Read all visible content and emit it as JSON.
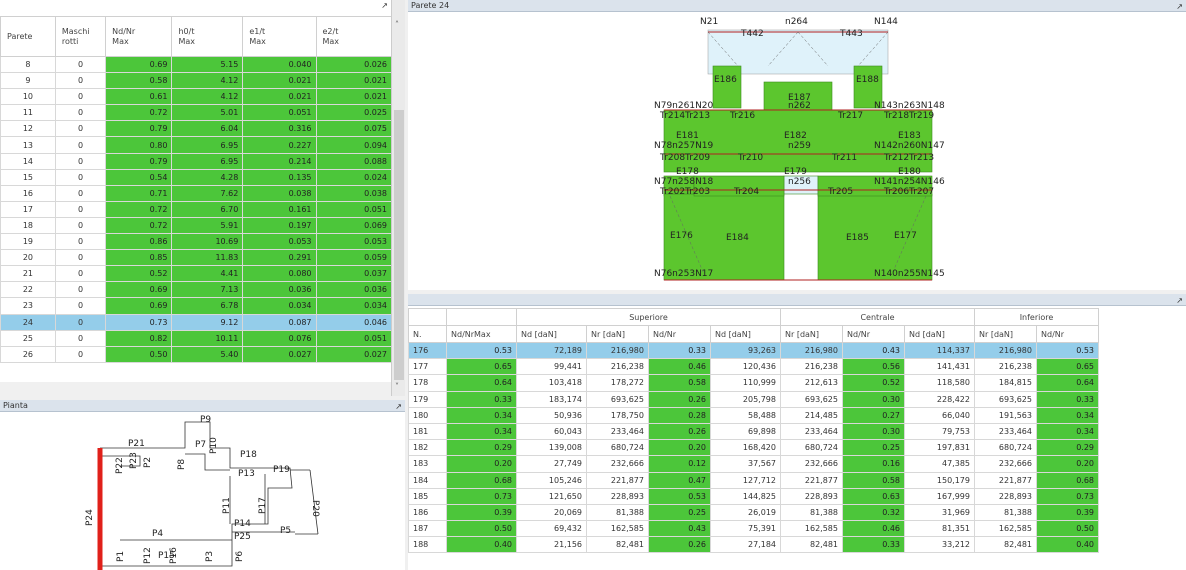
{
  "walls_table": {
    "headers": [
      "Parete",
      "Maschi\nrotti",
      "Nd/Nr\nMax",
      "h0/t\nMax",
      "e1/t\nMax",
      "e2/t\nMax"
    ],
    "rows": [
      [
        "8",
        "0",
        "0.69",
        "5.15",
        "0.040",
        "0.026"
      ],
      [
        "9",
        "0",
        "0.58",
        "4.12",
        "0.021",
        "0.021"
      ],
      [
        "10",
        "0",
        "0.61",
        "4.12",
        "0.021",
        "0.021"
      ],
      [
        "11",
        "0",
        "0.72",
        "5.01",
        "0.051",
        "0.025"
      ],
      [
        "12",
        "0",
        "0.79",
        "6.04",
        "0.316",
        "0.075"
      ],
      [
        "13",
        "0",
        "0.80",
        "6.95",
        "0.227",
        "0.094"
      ],
      [
        "14",
        "0",
        "0.79",
        "6.95",
        "0.214",
        "0.088"
      ],
      [
        "15",
        "0",
        "0.54",
        "4.28",
        "0.135",
        "0.024"
      ],
      [
        "16",
        "0",
        "0.71",
        "7.62",
        "0.038",
        "0.038"
      ],
      [
        "17",
        "0",
        "0.72",
        "6.70",
        "0.161",
        "0.051"
      ],
      [
        "18",
        "0",
        "0.72",
        "5.91",
        "0.197",
        "0.069"
      ],
      [
        "19",
        "0",
        "0.86",
        "10.69",
        "0.053",
        "0.053"
      ],
      [
        "20",
        "0",
        "0.85",
        "11.83",
        "0.291",
        "0.059"
      ],
      [
        "21",
        "0",
        "0.52",
        "4.41",
        "0.080",
        "0.037"
      ],
      [
        "22",
        "0",
        "0.69",
        "7.13",
        "0.036",
        "0.036"
      ],
      [
        "23",
        "0",
        "0.69",
        "6.78",
        "0.034",
        "0.034"
      ],
      [
        "24",
        "0",
        "0.73",
        "9.12",
        "0.087",
        "0.046"
      ],
      [
        "25",
        "0",
        "0.82",
        "10.11",
        "0.076",
        "0.051"
      ],
      [
        "26",
        "0",
        "0.50",
        "5.40",
        "0.027",
        "0.027"
      ]
    ],
    "selected_row": "24"
  },
  "plan": {
    "title": "Pianta",
    "labels": [
      "P9",
      "P21",
      "P22",
      "P2",
      "P7",
      "P10",
      "P8",
      "P18",
      "P13",
      "P19",
      "P20",
      "P11",
      "P17",
      "P14",
      "P25",
      "P5",
      "P4",
      "P1",
      "P3",
      "P15",
      "P6",
      "P24",
      "P16",
      "P12",
      "P23"
    ]
  },
  "elevation": {
    "title": "Parete 24",
    "labels": [
      "N21",
      "n264",
      "N144",
      "T442",
      "T443",
      "E186",
      "E188",
      "E187",
      "n262",
      "N79n261N20",
      "N143n263N148",
      "Tr214Tr213",
      "Tr216",
      "Tr217",
      "Tr218Tr219",
      "E181",
      "E182",
      "E183",
      "N78n257N19",
      "n259",
      "N142n260N147",
      "Tr208Tr209",
      "Tr210",
      "Tr211",
      "Tr212Tr213",
      "E178",
      "E179",
      "E180",
      "N77n258N18",
      "n256",
      "N141n254N146",
      "Tr202Tr203",
      "Tr204",
      "Tr205",
      "Tr206Tr207",
      "E176",
      "E184",
      "E185",
      "E177",
      "N76n253N17",
      "N140n255N145"
    ]
  },
  "results": {
    "group_headers": [
      "Superiore",
      "Centrale",
      "Inferiore"
    ],
    "col_headers": [
      "N.",
      "Nd/NrMax",
      "Nd [daN]",
      "Nr [daN]",
      "Nd/Nr",
      "Nd [daN]",
      "Nr [daN]",
      "Nd/Nr",
      "Nd [daN]",
      "Nr [daN]",
      "Nd/Nr"
    ],
    "rows": [
      [
        "176",
        "0.53",
        "72,189",
        "216,980",
        "0.33",
        "93,263",
        "216,980",
        "0.43",
        "114,337",
        "216,980",
        "0.53"
      ],
      [
        "177",
        "0.65",
        "99,441",
        "216,238",
        "0.46",
        "120,436",
        "216,238",
        "0.56",
        "141,431",
        "216,238",
        "0.65"
      ],
      [
        "178",
        "0.64",
        "103,418",
        "178,272",
        "0.58",
        "110,999",
        "212,613",
        "0.52",
        "118,580",
        "184,815",
        "0.64"
      ],
      [
        "179",
        "0.33",
        "183,174",
        "693,625",
        "0.26",
        "205,798",
        "693,625",
        "0.30",
        "228,422",
        "693,625",
        "0.33"
      ],
      [
        "180",
        "0.34",
        "50,936",
        "178,750",
        "0.28",
        "58,488",
        "214,485",
        "0.27",
        "66,040",
        "191,563",
        "0.34"
      ],
      [
        "181",
        "0.34",
        "60,043",
        "233,464",
        "0.26",
        "69,898",
        "233,464",
        "0.30",
        "79,753",
        "233,464",
        "0.34"
      ],
      [
        "182",
        "0.29",
        "139,008",
        "680,724",
        "0.20",
        "168,420",
        "680,724",
        "0.25",
        "197,831",
        "680,724",
        "0.29"
      ],
      [
        "183",
        "0.20",
        "27,749",
        "232,666",
        "0.12",
        "37,567",
        "232,666",
        "0.16",
        "47,385",
        "232,666",
        "0.20"
      ],
      [
        "184",
        "0.68",
        "105,246",
        "221,877",
        "0.47",
        "127,712",
        "221,877",
        "0.58",
        "150,179",
        "221,877",
        "0.68"
      ],
      [
        "185",
        "0.73",
        "121,650",
        "228,893",
        "0.53",
        "144,825",
        "228,893",
        "0.63",
        "167,999",
        "228,893",
        "0.73"
      ],
      [
        "186",
        "0.39",
        "20,069",
        "81,388",
        "0.25",
        "26,019",
        "81,388",
        "0.32",
        "31,969",
        "81,388",
        "0.39"
      ],
      [
        "187",
        "0.50",
        "69,432",
        "162,585",
        "0.43",
        "75,391",
        "162,585",
        "0.46",
        "81,351",
        "162,585",
        "0.50"
      ],
      [
        "188",
        "0.40",
        "21,156",
        "82,481",
        "0.26",
        "27,184",
        "82,481",
        "0.33",
        "33,212",
        "82,481",
        "0.40"
      ]
    ],
    "selected_row": "176"
  },
  "colors": {
    "ok_green": "#4cc63a",
    "selection_blue": "#94cdea",
    "wall_red": "#e0201a"
  }
}
